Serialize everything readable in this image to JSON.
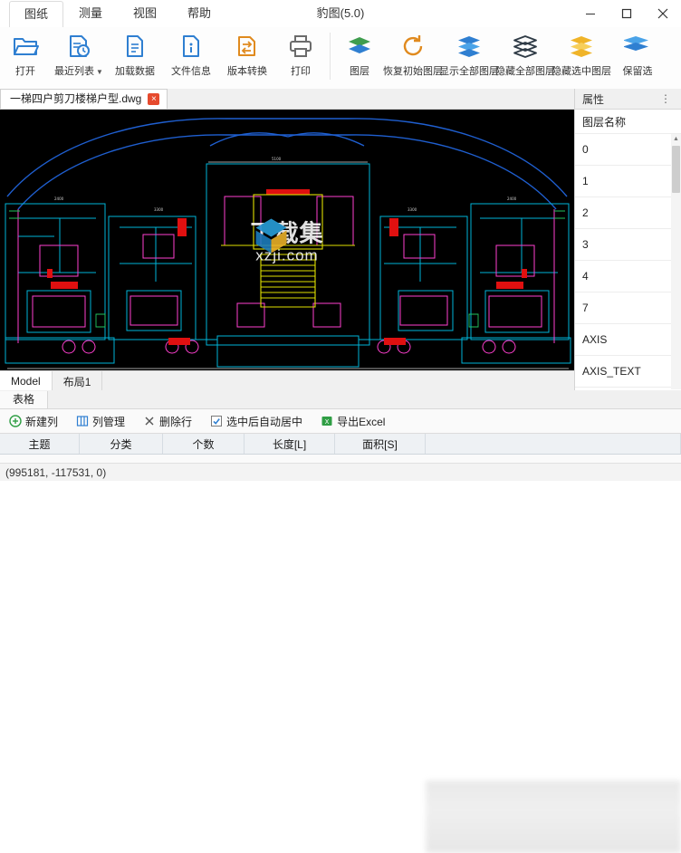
{
  "window": {
    "title": "豹图(5.0)",
    "tabs": [
      {
        "label": "图纸",
        "active": true
      },
      {
        "label": "测量",
        "active": false
      },
      {
        "label": "视图",
        "active": false
      },
      {
        "label": "帮助",
        "active": false
      }
    ],
    "controls": {
      "minimize": "minimize-icon",
      "maximize": "maximize-icon",
      "close": "close-icon"
    }
  },
  "ribbon": {
    "items": [
      {
        "label": "打开",
        "icon": "folder-open-icon",
        "dropdown": false
      },
      {
        "label": "最近列表",
        "icon": "recent-list-icon",
        "dropdown": true
      },
      {
        "label": "加载数据",
        "icon": "load-data-icon",
        "dropdown": false
      },
      {
        "label": "文件信息",
        "icon": "file-info-icon",
        "dropdown": false
      },
      {
        "label": "版本转换",
        "icon": "version-convert-icon",
        "dropdown": false
      },
      {
        "label": "打印",
        "icon": "print-icon",
        "dropdown": false
      },
      {
        "label": "图层",
        "icon": "layers-icon",
        "dropdown": false
      },
      {
        "label": "恢复初始图层",
        "icon": "restore-layers-icon",
        "dropdown": false
      },
      {
        "label": "显示全部图层",
        "icon": "show-all-layers-icon",
        "dropdown": false
      },
      {
        "label": "隐藏全部图层",
        "icon": "hide-all-layers-icon",
        "dropdown": false
      },
      {
        "label": "隐藏选中图层",
        "icon": "hide-selected-layers-icon",
        "dropdown": false
      },
      {
        "label": "保留选",
        "icon": "keep-selected-layers-icon",
        "dropdown": false
      }
    ]
  },
  "document": {
    "tab_label": "一梯四户剪刀楼梯户型.dwg",
    "close_label": "×",
    "watermark_main": "下载集",
    "watermark_sub": "xzji.com",
    "view_tabs": [
      {
        "label": "Model",
        "active": true
      },
      {
        "label": "布局1",
        "active": false
      }
    ]
  },
  "properties": {
    "title": "属性",
    "menu_glyph": "⋮",
    "column_header": "图层名称",
    "layers": [
      "0",
      "1",
      "2",
      "3",
      "4",
      "7",
      "AXIS",
      "AXIS_TEXT"
    ]
  },
  "grid": {
    "tab_label": "表格",
    "tools": [
      {
        "label": "新建列",
        "icon": "add-column-icon"
      },
      {
        "label": "列管理",
        "icon": "column-manage-icon"
      },
      {
        "label": "删除行",
        "icon": "delete-row-icon"
      },
      {
        "label": "选中后自动居中",
        "icon": "checkbox-checked-icon"
      },
      {
        "label": "导出Excel",
        "icon": "export-excel-icon"
      }
    ],
    "columns": [
      "主题",
      "分类",
      "个数",
      "长度[L]",
      "面积[S]"
    ]
  },
  "status": {
    "coordinates": "(995181, -117531, 0)"
  },
  "colors": {
    "accent_blue": "#2f7fd1",
    "close_red": "#e64a2e",
    "canvas_bg": "#000000",
    "ribbon_bg": "#fdfdfd",
    "grid_header_bg": "#eef1f4"
  }
}
